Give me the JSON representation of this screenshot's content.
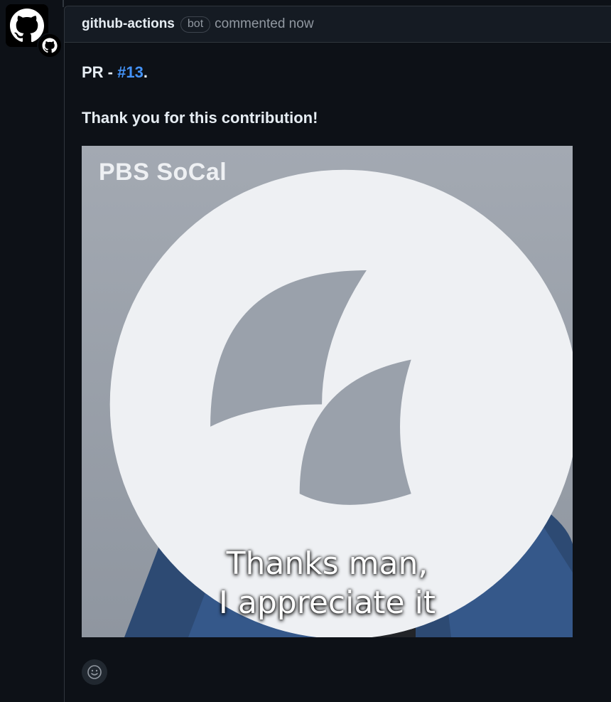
{
  "comment": {
    "author": "github-actions",
    "bot_label": "bot",
    "action_text": "commented now",
    "pr_prefix": "PR - ",
    "pr_link": "#13",
    "pr_suffix": ".",
    "message": "Thank you for this contribution!"
  },
  "gif": {
    "logo_text": "PBS SoCal",
    "caption_line1": "Thanks man,",
    "caption_line2": "I appreciate it"
  },
  "icons": {
    "avatar": "github-octocat-icon",
    "avatar_badge": "github-app-icon",
    "reaction": "smiley-icon"
  },
  "colors": {
    "background": "#0d1117",
    "header": "#151b23",
    "link": "#4493f8",
    "muted": "#9198a1"
  }
}
